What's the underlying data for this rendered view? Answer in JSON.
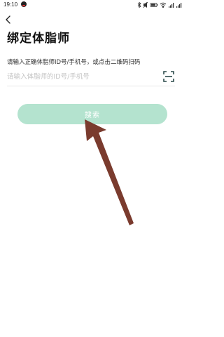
{
  "status_bar": {
    "time": "19:10",
    "icons": [
      "notification-app-icon",
      "bluetooth-icon",
      "mute-icon",
      "battery-icon",
      "wifi-icon",
      "signal-icon",
      "signal-icon"
    ]
  },
  "header": {
    "back_icon": "back-arrow-icon",
    "title": "绑定体脂师"
  },
  "form": {
    "instruction": "请输入正确体脂师ID号/手机号，或点击二维码扫码",
    "input_value": "",
    "input_placeholder": "请输入体脂师的ID号/手机号",
    "scan_icon": "qr-scan-icon"
  },
  "actions": {
    "search_label": "搜索"
  },
  "colors": {
    "button_bg": "#b4e3cf",
    "button_text": "#ffffff",
    "annotation_arrow": "#7a3b2e",
    "placeholder": "#c4c4c4"
  }
}
